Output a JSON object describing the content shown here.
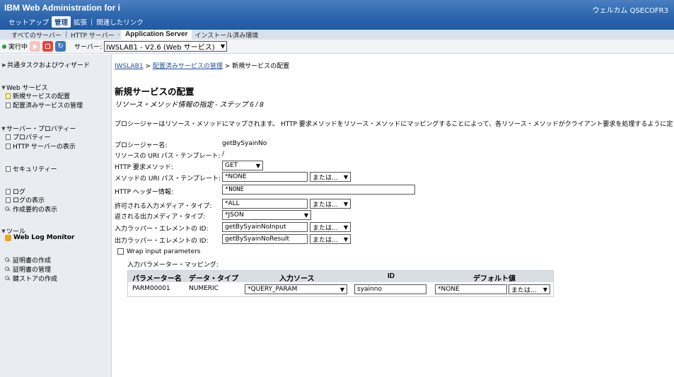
{
  "header": {
    "title": "IBM Web Administration for i",
    "welcome": "ウェルカム QSECOFR3",
    "nav": [
      "セットアップ",
      "管理",
      "拡張",
      "関連したリンク"
    ]
  },
  "tabs": [
    "すべてのサーバー",
    "HTTP サーバー",
    "Application Server",
    "インストール済み環境"
  ],
  "status": {
    "state": "実行中",
    "server_label": "サーバー:",
    "server_value": "IWSLAB1 - V2.6 (Web サービス)",
    "colors": {
      "running": "#2e9a3c",
      "stop": "#e8433a",
      "refresh": "#3f78c4"
    }
  },
  "sidebar": {
    "common_tasks": "共通タスクおよびウィザード",
    "web_services": "Web サービス",
    "deploy_new": "新規サービスの配置",
    "manage_deployed": "配置済みサービスの管理",
    "server_props": "サーバー・プロパティー",
    "properties": "プロパティー",
    "show_http": "HTTP サーバーの表示",
    "security": "セキュリティー",
    "logs": "ログ",
    "view_logs": "ログの表示",
    "show_summary": "作成要約の表示",
    "tools": "ツール",
    "web_log_monitor": "Web Log Monitor",
    "create_cert": "証明書の作成",
    "manage_cert": "証明書の管理",
    "create_keystore": "鍵ストアの作成"
  },
  "breadcrumb": {
    "server": "IWSLAB1",
    "sep": " > ",
    "manage": "配置済みサービスの管理",
    "current": "新規サービスの配置"
  },
  "page": {
    "title": "新規サービスの配置",
    "subtitle": "リソース・メソッド情報の指定 - ステップ 6 / 8",
    "description": "プロシージャーはリソース・メソッドにマップされます。 HTTP 要求メソッドをリソース・メソッドにマッピングすることによって、各リソース・メソッドがクライアント要求を処理するように定"
  },
  "form": {
    "procedure_label": "プロシージャー名:",
    "procedure_value": "getBySyainNo",
    "uri_template_label": "リソースの URI パス・テンプレート:",
    "uri_template_value": "/",
    "http_method_label": "HTTP 要求メソッド:",
    "http_method_value": "GET",
    "method_uri_label": "メソッドの URI パス・テンプレート:",
    "method_uri_value": "*NONE",
    "or_label": "または...",
    "http_header_label": "HTTP ヘッダー情報:",
    "http_header_value": "*NONE",
    "input_media_label": "許可される入力メディア・タイプ:",
    "input_media_value": "*ALL",
    "output_media_label": "返される出力メディア・タイプ:",
    "output_media_value": "*JSON",
    "input_wrapper_label": "入力ラッパー・エレメントの ID:",
    "input_wrapper_value": "getBySyainNoInput",
    "output_wrapper_label": "出力ラッパー・エレメントの ID:",
    "output_wrapper_value": "getBySyainNoResult",
    "wrap_label": "Wrap input parameters",
    "mapping_label": "入力パラメーター・マッピング:"
  },
  "param_table": {
    "headers": [
      "パラメーター名",
      "データ・タイプ",
      "入力ソース",
      "ID",
      "デフォルト値"
    ],
    "rows": [
      {
        "name": "PARM00001",
        "type": "NUMERIC",
        "source": "*QUERY_PARAM",
        "id": "syainno",
        "default": "*NONE",
        "or": "または..."
      }
    ]
  }
}
